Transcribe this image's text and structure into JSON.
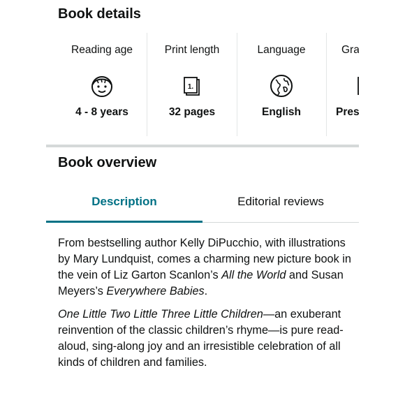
{
  "book_details": {
    "title": "Book details",
    "items": [
      {
        "label": "Reading age",
        "value": "4 - 8 years",
        "icon": "child-face-icon"
      },
      {
        "label": "Print length",
        "value": "32 pages",
        "icon": "page-count-icon",
        "icon_text": "1."
      },
      {
        "label": "Language",
        "value": "English",
        "icon": "globe-icon"
      },
      {
        "label": "Gra",
        "value": "Pres",
        "icon": "grade-icon"
      }
    ]
  },
  "book_overview": {
    "title": "Book overview",
    "tabs": [
      {
        "label": "Description",
        "active": true
      },
      {
        "label": "Editorial reviews",
        "active": false
      }
    ],
    "description": {
      "p1_text": "From bestselling author Kelly DiPucchio, with illustrations by Mary Lundquist, comes a charming new picture book in the vein of Liz Garton Scanlon’s ",
      "p1_italic1": "All the World",
      "p1_mid": " and Susan Meyers’s ",
      "p1_italic2": "Everywhere Babies",
      "p1_end": ".",
      "p2_italic": "One Little Two Little Three Little Children",
      "p2_text": "—an exuberant reinvention of the classic children’s rhyme—is pure read-aloud, sing-along joy and an irresistible celebration of all kinds of children and families."
    }
  },
  "colors": {
    "accent": "#007185",
    "text": "#0f1111",
    "divider": "#d5d9d9"
  }
}
